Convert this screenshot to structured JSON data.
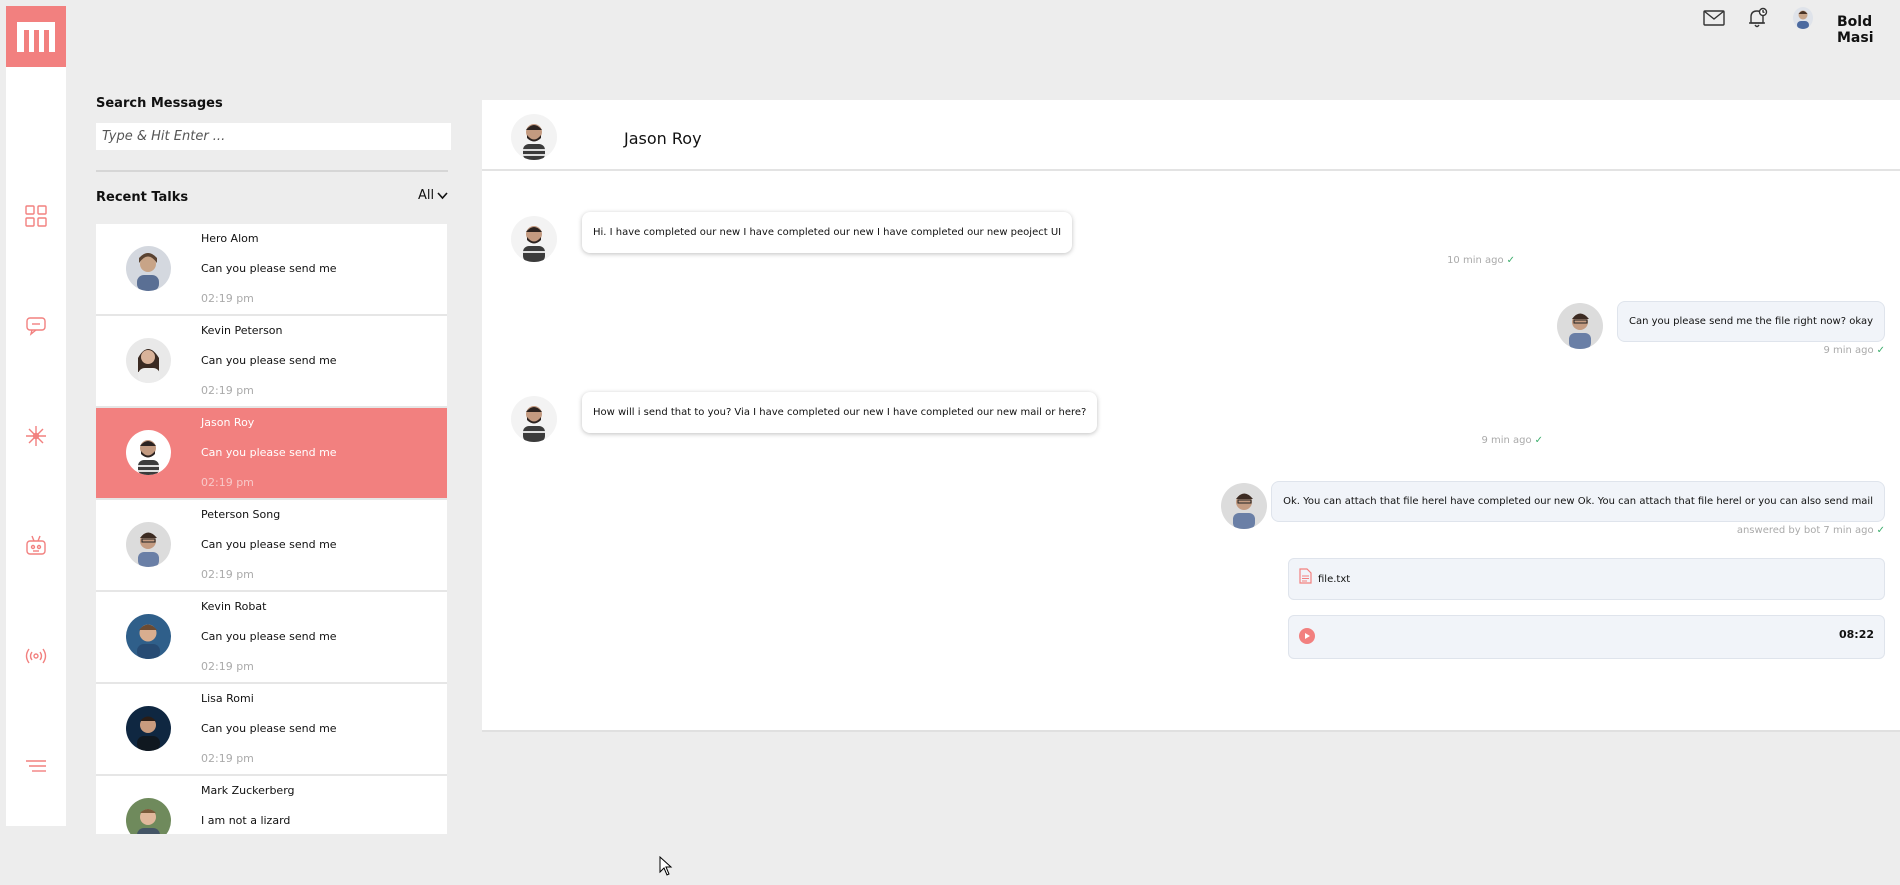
{
  "app": {
    "brand_color": "#f2807f",
    "logo_letter": "m"
  },
  "rail_icons": [
    "dashboard-icon",
    "chat-icon",
    "network-icon",
    "bot-icon",
    "broadcast-icon",
    "menu-icon"
  ],
  "topbar": {
    "icons": [
      "mail-icon",
      "notification-bell-icon",
      "user-avatar"
    ],
    "username": "Bold Masi"
  },
  "search": {
    "label": "Search Messages",
    "placeholder": "Type & Hit Enter ..."
  },
  "recent": {
    "label": "Recent Talks",
    "filter": "All",
    "talks": [
      {
        "name": "Hero Alom",
        "message": "Can you please send me",
        "time": "02:19 pm",
        "active": false
      },
      {
        "name": "Kevin Peterson",
        "message": "Can you please send me",
        "time": "02:19 pm",
        "active": false
      },
      {
        "name": "Jason Roy",
        "message": "Can you please send me",
        "time": "02:19 pm",
        "active": true
      },
      {
        "name": "Peterson Song",
        "message": "Can you please send me",
        "time": "02:19 pm",
        "active": false
      },
      {
        "name": "Kevin Robat",
        "message": "Can you please send me",
        "time": "02:19 pm",
        "active": false
      },
      {
        "name": "Lisa Romi",
        "message": "Can you please send me",
        "time": "02:19 pm",
        "active": false
      },
      {
        "name": "Mark Zuckerberg",
        "message": "I am not a lizard",
        "time": "",
        "active": false
      }
    ]
  },
  "chat": {
    "title": "Jason Roy",
    "messages": [
      {
        "text": "Hi. I have completed our new I have completed our new I have completed our new peoject UI",
        "meta": "10 min ago"
      },
      {
        "text": "Can you please send me the file right now? okay",
        "meta": "9 min ago"
      },
      {
        "text": "How will i send that to you? Via I have completed our new I have completed our new mail or here?",
        "meta": "9 min ago"
      },
      {
        "text": "Ok. You can attach that file herel have completed our new Ok. You can attach that file herel or you can also send mail",
        "meta": "answered by bot 7 min ago"
      }
    ],
    "attachment": {
      "file_name": "file.txt"
    },
    "audio": {
      "duration": "08:22"
    }
  }
}
